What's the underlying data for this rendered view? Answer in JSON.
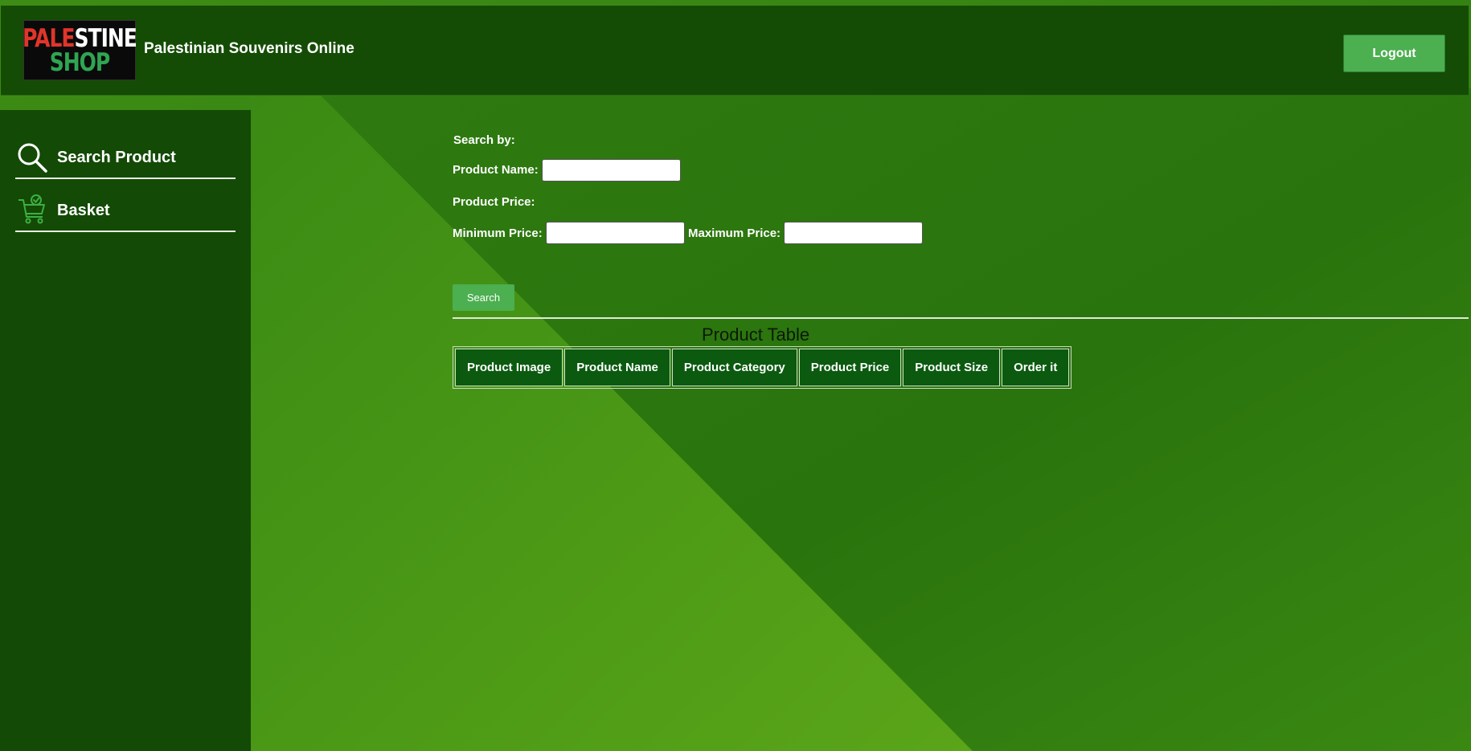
{
  "header": {
    "logo": {
      "line1_red": "PALE",
      "line1_white": "STINE",
      "line2": "SHOP"
    },
    "site_title": "Palestinian Souvenirs Online",
    "logout_label": "Logout"
  },
  "sidebar": {
    "items": [
      {
        "label": "Search Product",
        "icon": "search-icon"
      },
      {
        "label": "Basket",
        "icon": "cart-icon"
      }
    ]
  },
  "search_form": {
    "search_by_label": "Search by:",
    "product_name_label": "Product Name:",
    "product_name_value": "",
    "product_price_label": "Product Price:",
    "min_price_label": "Minimum Price:",
    "min_price_value": "",
    "max_price_label": "Maximum Price:",
    "max_price_value": "",
    "search_button_label": "Search"
  },
  "product_table": {
    "caption": "Product Table",
    "columns": [
      "Product Image",
      "Product Name",
      "Product Category",
      "Product Price",
      "Product Size",
      "Order it"
    ]
  },
  "colors": {
    "header_bg": "#144c05",
    "sidebar_bg": "#134a05",
    "accent_button": "#4caf50",
    "table_header_bg": "#0b5a10"
  }
}
